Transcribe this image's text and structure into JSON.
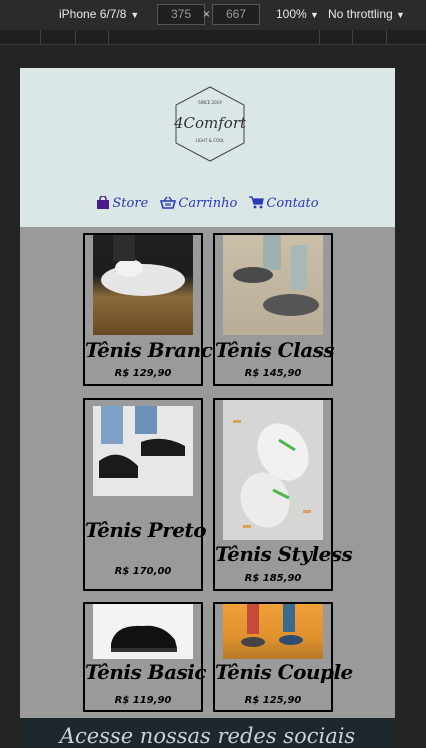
{
  "devtools": {
    "device": "iPhone 6/7/8",
    "width": "375",
    "height": "667",
    "times": "×",
    "zoom": "100%",
    "throttle": "No throttling"
  },
  "brand": {
    "logo_top": "SINCE 2019",
    "logo_name": "4Comfort",
    "logo_sub": "LIGHT & COOL"
  },
  "nav": [
    {
      "label": "Store",
      "icon": "shopping-bag-icon"
    },
    {
      "label": "Carrinho",
      "icon": "shopping-basket-icon"
    },
    {
      "label": "Contato",
      "icon": "shopping-cart-icon"
    }
  ],
  "products": [
    {
      "name": "Tênis Branco",
      "price": "R$ 129,90",
      "image": "white-sneaker-on-wood-image"
    },
    {
      "name": "Tênis Class",
      "price": "R$ 145,90",
      "image": "gray-sneaker-image"
    },
    {
      "name": "Tênis Preto",
      "price": "R$ 170,00",
      "image": "black-sneaker-image"
    },
    {
      "name": "Tênis Styless",
      "price": "R$ 185,90",
      "image": "white-green-sneaker-image"
    },
    {
      "name": "Tênis Basic",
      "price": "R$ 119,90",
      "image": "black-basic-sneaker-image"
    },
    {
      "name": "Tênis Couple",
      "price": "R$ 125,90",
      "image": "couple-sneakers-image"
    }
  ],
  "footer": {
    "text": "Acesse nossas redes sociais"
  },
  "colors": {
    "header_bg": "#dbe6e6",
    "body_bg": "#9a9a9a",
    "nav_link": "#2a39b6"
  }
}
